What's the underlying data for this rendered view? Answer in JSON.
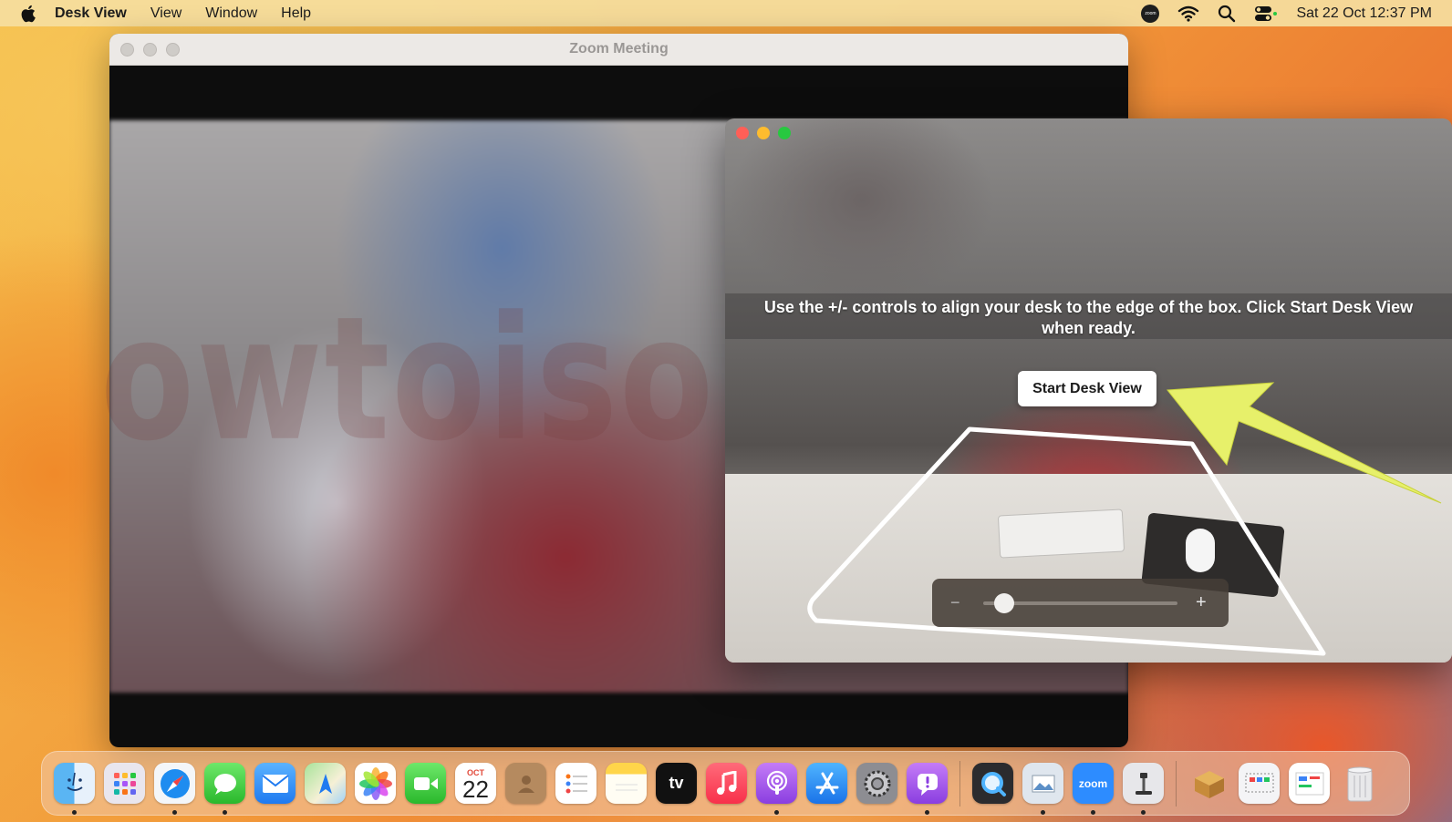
{
  "menubar": {
    "app_name": "Desk View",
    "items": [
      "View",
      "Window",
      "Help"
    ],
    "status_zoom_text": "zoom",
    "datetime": "Sat 22 Oct  12:37 PM"
  },
  "zoom_window": {
    "title": "Zoom Meeting"
  },
  "desk_view": {
    "instruction": "Use the +/- controls to align your desk to the edge of the box. Click Start Desk View when ready.",
    "start_button": "Start Desk View",
    "zoom_minus": "−",
    "zoom_plus": "+",
    "zoom_level": 0.11
  },
  "watermark": "owtoisolve.com",
  "dock": {
    "calendar_month": "OCT",
    "calendar_day": "22",
    "tv_label": "tv",
    "zoom_label": "zoom",
    "icons": [
      "finder-icon",
      "launchpad-icon",
      "safari-icon",
      "messages-icon",
      "mail-icon",
      "maps-icon",
      "photos-icon",
      "facetime-icon",
      "calendar-icon",
      "contacts-icon",
      "reminders-icon",
      "notes-icon",
      "apple-tv-icon",
      "music-icon",
      "podcasts-icon",
      "app-store-icon",
      "system-settings-icon",
      "feedback-icon",
      "quicktime-icon",
      "preview-icon",
      "zoom-icon",
      "desk-view-icon",
      "installer-icon",
      "screenshot-icon",
      "freeform-icon",
      "trash-icon"
    ]
  },
  "colors": {
    "annotation_arrow": "#e7f06a",
    "traffic_close": "#ff5f57",
    "traffic_minimize": "#febc2e",
    "traffic_maximize": "#28c840"
  }
}
